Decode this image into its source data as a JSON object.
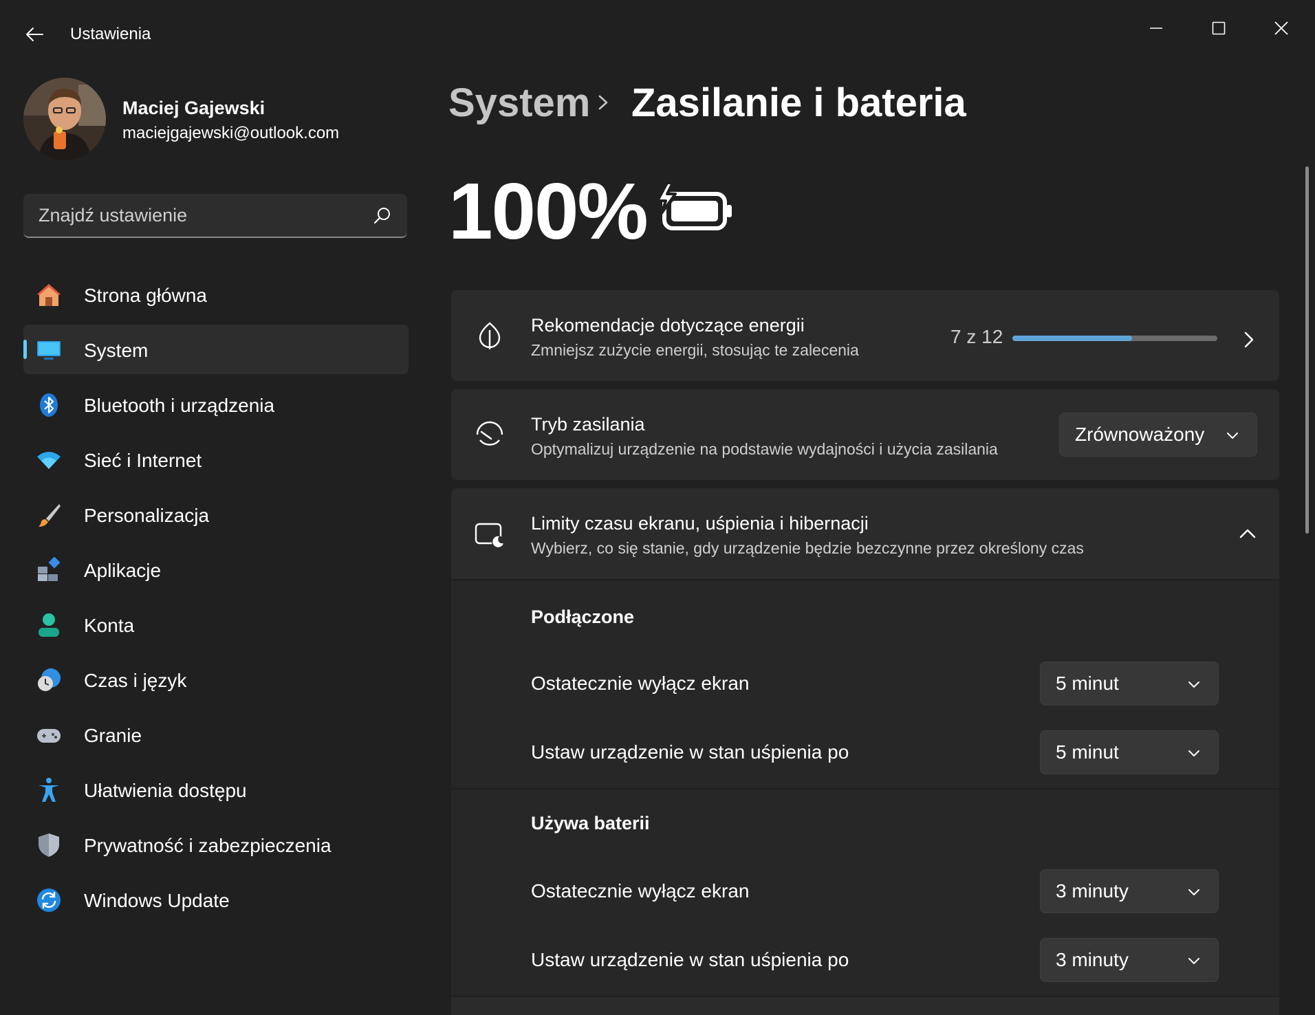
{
  "window": {
    "app_title": "Ustawienia"
  },
  "profile": {
    "name": "Maciej Gajewski",
    "email": "maciejgajewski@outlook.com"
  },
  "search": {
    "placeholder": "Znajdź ustawienie"
  },
  "nav": {
    "items": [
      {
        "label": "Strona główna",
        "icon": "home-icon"
      },
      {
        "label": "System",
        "icon": "system-icon",
        "active": true
      },
      {
        "label": "Bluetooth i urządzenia",
        "icon": "bluetooth-icon"
      },
      {
        "label": "Sieć i Internet",
        "icon": "wifi-icon"
      },
      {
        "label": "Personalizacja",
        "icon": "brush-icon"
      },
      {
        "label": "Aplikacje",
        "icon": "apps-icon"
      },
      {
        "label": "Konta",
        "icon": "account-icon"
      },
      {
        "label": "Czas i język",
        "icon": "time-language-icon"
      },
      {
        "label": "Granie",
        "icon": "gamepad-icon"
      },
      {
        "label": "Ułatwienia dostępu",
        "icon": "accessibility-icon"
      },
      {
        "label": "Prywatność i zabezpieczenia",
        "icon": "shield-icon"
      },
      {
        "label": "Windows Update",
        "icon": "update-icon"
      }
    ]
  },
  "header": {
    "parent": "System",
    "current": "Zasilanie i bateria"
  },
  "battery": {
    "percent": "100%",
    "charging": true
  },
  "recommendations": {
    "title": "Rekomendacje dotyczące energii",
    "subtitle": "Zmniejsz zużycie energii, stosując te zalecenia",
    "count": "7 z 12",
    "progress_fraction": 0.583
  },
  "power_mode": {
    "title": "Tryb zasilania",
    "subtitle": "Optymalizuj urządzenie na podstawie wydajności i użycia zasilania",
    "value": "Zrównoważony"
  },
  "timeouts": {
    "title": "Limity czasu ekranu, uśpienia i hibernacji",
    "subtitle": "Wybierz, co się stanie, gdy urządzenie będzie bezczynne przez określony czas",
    "plugged": {
      "title": "Podłączone",
      "screen_label": "Ostatecznie wyłącz ekran",
      "screen_value": "5 minut",
      "sleep_label": "Ustaw urządzenie w stan uśpienia po",
      "sleep_value": "5 minut"
    },
    "battery": {
      "title": "Używa baterii",
      "screen_label": "Ostatecznie wyłącz ekran",
      "screen_value": "3 minuty",
      "sleep_label": "Ustaw urządzenie w stan uśpienia po",
      "sleep_value": "3 minuty"
    }
  },
  "colors": {
    "accent": "#60cdff",
    "progress": "#5fa4d7",
    "background": "#202020",
    "card": "#2b2b2b"
  }
}
